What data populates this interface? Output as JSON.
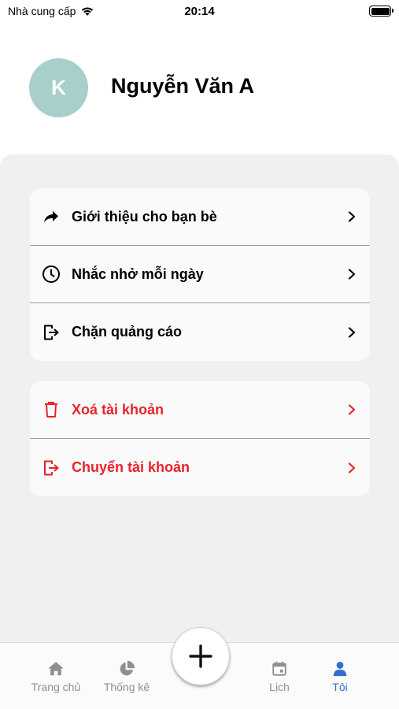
{
  "status_bar": {
    "carrier": "Nhà cung cấp",
    "time": "20:14"
  },
  "profile": {
    "avatar_initial": "K",
    "name": "Nguyễn Văn A",
    "avatar_color": "#a9cfcc"
  },
  "menu": {
    "items": [
      {
        "label": "Giới thiệu cho bạn bè",
        "icon": "share-arrow-icon"
      },
      {
        "label": "Nhắc nhở mỗi ngày",
        "icon": "clock-icon"
      },
      {
        "label": "Chặn quảng cáo",
        "icon": "exit-icon"
      }
    ],
    "danger_items": [
      {
        "label": "Xoá tài khoản",
        "icon": "trash-icon"
      },
      {
        "label": "Chuyển tài khoản",
        "icon": "exit-icon"
      }
    ]
  },
  "tabs": [
    {
      "label": "Trang chủ",
      "icon": "home-icon",
      "active": false
    },
    {
      "label": "Thống kê",
      "icon": "pie-chart-icon",
      "active": false
    },
    {
      "label": "Lịch",
      "icon": "calendar-icon",
      "active": false
    },
    {
      "label": "Tôi",
      "icon": "person-icon",
      "active": true
    }
  ],
  "fab": {
    "icon": "plus-icon"
  },
  "colors": {
    "danger": "#e8232b",
    "active_tab": "#2f6fd2",
    "inactive_tab": "#8e8e93",
    "panel_bg": "#f0f0f0"
  }
}
